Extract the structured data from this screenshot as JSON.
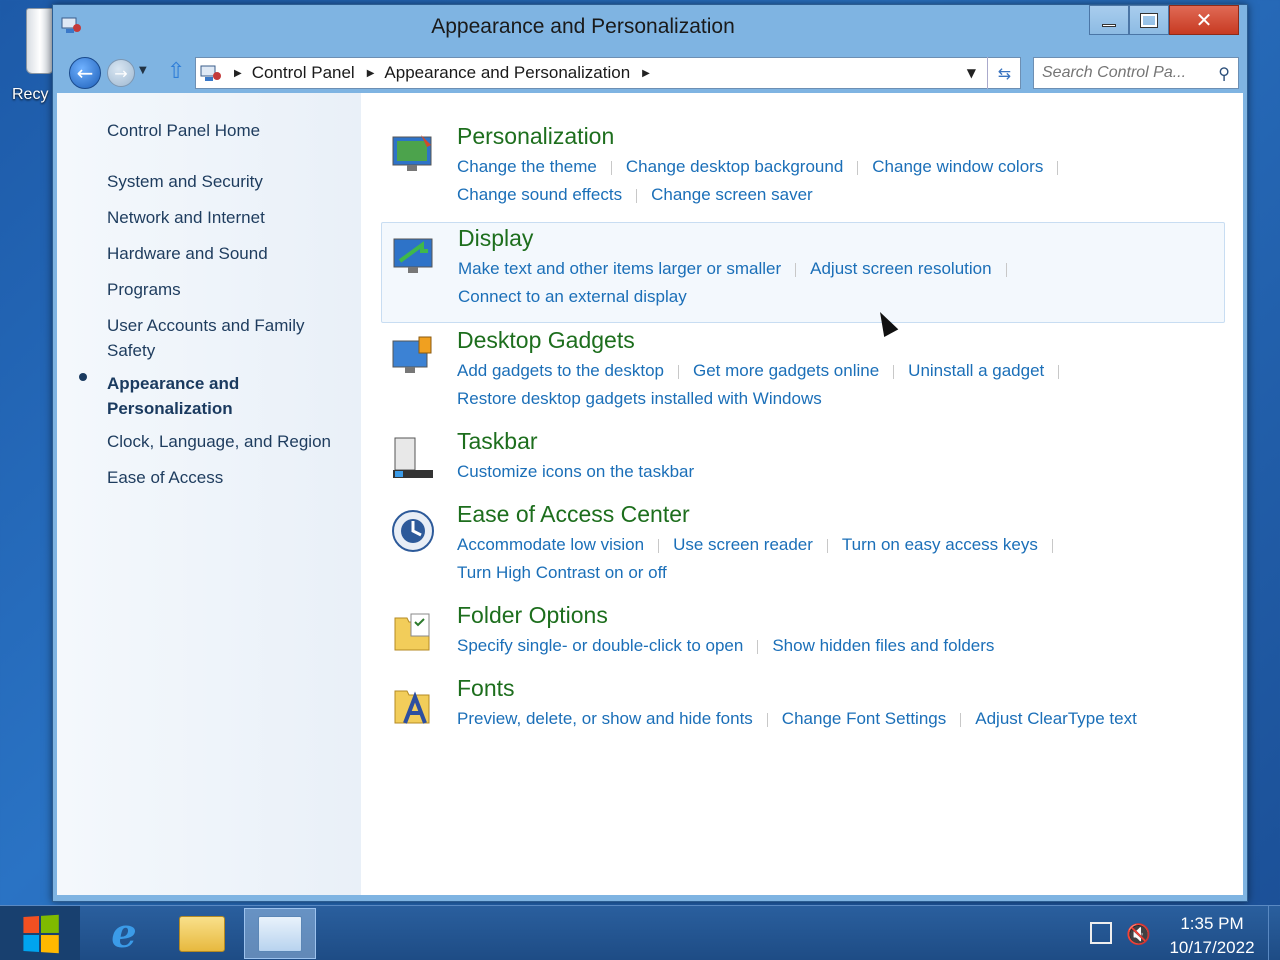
{
  "desktop": {
    "recycle_bin_label": "Recy"
  },
  "window": {
    "title": "Appearance and Personalization",
    "caption": {
      "close": "✕"
    }
  },
  "navigation": {
    "breadcrumbs": [
      "Control Panel",
      "Appearance and Personalization"
    ],
    "search_placeholder": "Search Control Pa..."
  },
  "sidebar": {
    "home": "Control Panel Home",
    "items": [
      "System and Security",
      "Network and Internet",
      "Hardware and Sound",
      "Programs",
      "User Accounts and Family Safety",
      "Appearance and Personalization",
      "Clock, Language, and Region",
      "Ease of Access"
    ],
    "active_item": "Appearance and Personalization"
  },
  "categories": [
    {
      "title": "Personalization",
      "icon": "personalization-icon",
      "links": [
        "Change the theme",
        "Change desktop background",
        "Change window colors",
        "Change sound effects",
        "Change screen saver"
      ]
    },
    {
      "title": "Display",
      "icon": "display-icon",
      "links": [
        "Make text and other items larger or smaller",
        "Adjust screen resolution",
        "Connect to an external display"
      ]
    },
    {
      "title": "Desktop Gadgets",
      "icon": "gadgets-icon",
      "links": [
        "Add gadgets to the desktop",
        "Get more gadgets online",
        "Uninstall a gadget",
        "Restore desktop gadgets installed with Windows"
      ]
    },
    {
      "title": "Taskbar",
      "icon": "taskbar-icon",
      "links": [
        "Customize icons on the taskbar"
      ]
    },
    {
      "title": "Ease of Access Center",
      "icon": "ease-of-access-icon",
      "links": [
        "Accommodate low vision",
        "Use screen reader",
        "Turn on easy access keys",
        "Turn High Contrast on or off"
      ]
    },
    {
      "title": "Folder Options",
      "icon": "folder-options-icon",
      "links": [
        "Specify single- or double-click to open",
        "Show hidden files and folders"
      ]
    },
    {
      "title": "Fonts",
      "icon": "fonts-icon",
      "links": [
        "Preview, delete, or show and hide fonts",
        "Change Font Settings",
        "Adjust ClearType text"
      ]
    }
  ],
  "taskbar": {
    "time": "1:35 PM",
    "date": "10/17/2022"
  },
  "colors": {
    "link": "#1b6fb8",
    "category_title": "#1d6e1d",
    "taskbar": "#1e4c85"
  }
}
